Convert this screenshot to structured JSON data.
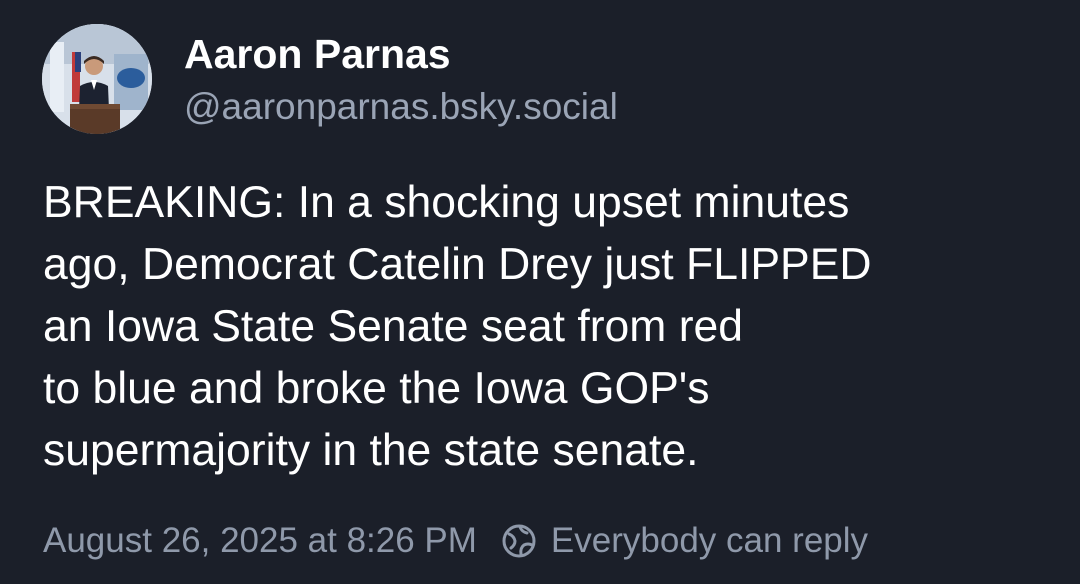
{
  "author": {
    "display_name": "Aaron Parnas",
    "handle": "@aaronparnas.bsky.social",
    "avatar_icon": "profile-photo-at-podium"
  },
  "post": {
    "text_lines": [
      "BREAKING: In a shocking upset minutes",
      "ago, Democrat Catelin Drey just FLIPPED",
      "an Iowa State Senate seat from red",
      "to blue and broke the Iowa GOP's",
      "supermajority in the state senate."
    ],
    "timestamp": "August 26, 2025 at 8:26 PM",
    "reply_setting_icon": "globe-icon",
    "reply_setting": "Everybody can reply"
  },
  "colors": {
    "background": "#1b1f29",
    "primary_text": "#ffffff",
    "secondary_text": "#9aa4b5"
  }
}
